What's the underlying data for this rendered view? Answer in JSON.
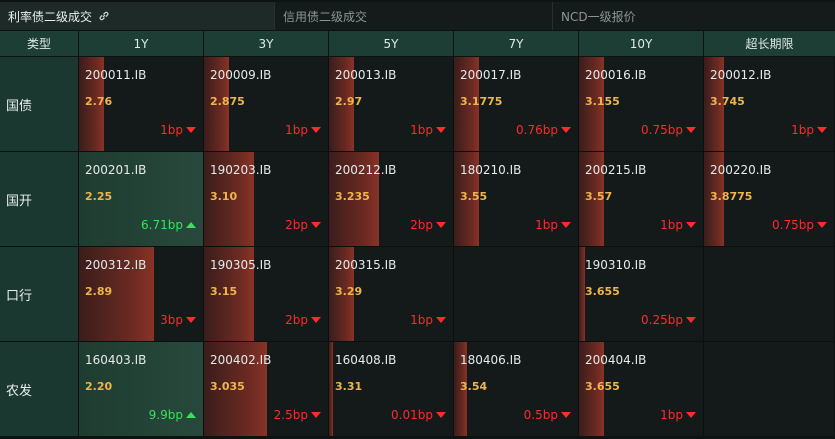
{
  "tabs": [
    {
      "label": "利率债二级成交",
      "active": true
    },
    {
      "label": "信用债二级成交",
      "active": false
    },
    {
      "label": "NCD一级报价",
      "active": false
    }
  ],
  "columns": [
    "类型",
    "1Y",
    "3Y",
    "5Y",
    "7Y",
    "10Y",
    "超长期限"
  ],
  "rows": [
    {
      "type": "国债",
      "cells": [
        {
          "code": "200011.IB",
          "yield": "2.76",
          "change": "1bp",
          "dir": "down",
          "bar": 0.2
        },
        {
          "code": "200009.IB",
          "yield": "2.875",
          "change": "1bp",
          "dir": "down",
          "bar": 0.2
        },
        {
          "code": "200013.IB",
          "yield": "2.97",
          "change": "1bp",
          "dir": "down",
          "bar": 0.2
        },
        {
          "code": "200017.IB",
          "yield": "3.1775",
          "change": "0.76bp",
          "dir": "down",
          "bar": 0.2
        },
        {
          "code": "200016.IB",
          "yield": "3.155",
          "change": "0.75bp",
          "dir": "down",
          "bar": 0.2
        },
        {
          "code": "200012.IB",
          "yield": "3.745",
          "change": "1bp",
          "dir": "down",
          "bar": 0.15
        }
      ]
    },
    {
      "type": "国开",
      "cells": [
        {
          "code": "200201.IB",
          "yield": "2.25",
          "change": "6.71bp",
          "dir": "up",
          "bar": 1.0
        },
        {
          "code": "190203.IB",
          "yield": "3.10",
          "change": "2bp",
          "dir": "down",
          "bar": 0.4
        },
        {
          "code": "200212.IB",
          "yield": "3.235",
          "change": "2bp",
          "dir": "down",
          "bar": 0.4
        },
        {
          "code": "180210.IB",
          "yield": "3.55",
          "change": "1bp",
          "dir": "down",
          "bar": 0.2
        },
        {
          "code": "200215.IB",
          "yield": "3.57",
          "change": "1bp",
          "dir": "down",
          "bar": 0.2
        },
        {
          "code": "200220.IB",
          "yield": "3.8775",
          "change": "0.75bp",
          "dir": "down",
          "bar": 0.15
        }
      ]
    },
    {
      "type": "口行",
      "cells": [
        {
          "code": "200312.IB",
          "yield": "2.89",
          "change": "3bp",
          "dir": "down",
          "bar": 0.6
        },
        {
          "code": "190305.IB",
          "yield": "3.15",
          "change": "2bp",
          "dir": "down",
          "bar": 0.4
        },
        {
          "code": "200315.IB",
          "yield": "3.29",
          "change": "1bp",
          "dir": "down",
          "bar": 0.2
        },
        null,
        {
          "code": "190310.IB",
          "yield": "3.655",
          "change": "0.25bp",
          "dir": "down",
          "bar": 0.05
        },
        null
      ]
    },
    {
      "type": "农发",
      "cells": [
        {
          "code": "160403.IB",
          "yield": "2.20",
          "change": "9.9bp",
          "dir": "up",
          "bar": 1.0
        },
        {
          "code": "200402.IB",
          "yield": "3.035",
          "change": "2.5bp",
          "dir": "down",
          "bar": 0.5
        },
        {
          "code": "160408.IB",
          "yield": "3.31",
          "change": "0.01bp",
          "dir": "down",
          "bar": 0.0
        },
        {
          "code": "180406.IB",
          "yield": "3.54",
          "change": "0.5bp",
          "dir": "down",
          "bar": 0.1
        },
        {
          "code": "200404.IB",
          "yield": "3.655",
          "change": "1bp",
          "dir": "down",
          "bar": 0.2
        },
        null
      ]
    }
  ]
}
